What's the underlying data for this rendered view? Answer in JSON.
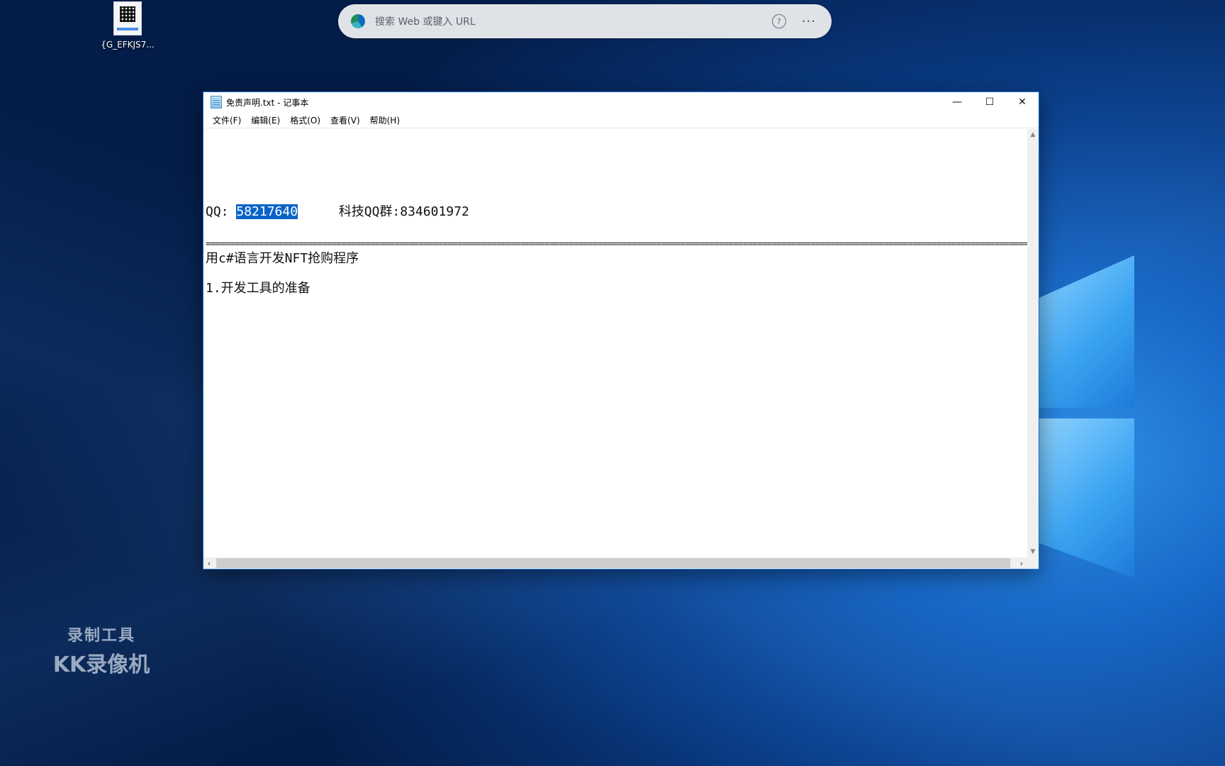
{
  "desktop": {
    "icon_label": "{G_EFKJS7...",
    "watermark_line1": "录制工具",
    "watermark_line2": "KK录像机"
  },
  "browser_bar": {
    "placeholder": "搜索 Web 或键入 URL",
    "help_glyph": "?",
    "more_glyph": "···"
  },
  "notepad": {
    "title": "免责声明.txt - 记事本",
    "menu": [
      "文件(F)",
      "编辑(E)",
      "格式(O)",
      "查看(V)",
      "帮助(H)"
    ],
    "content": {
      "qq_label": "QQ:",
      "qq_number": "58217640",
      "group_text": "科技QQ群:834601972",
      "separator": "==================================================================================================================================================================================",
      "line_title": "用c#语言开发NFT抢购程序",
      "line_item1": "1.开发工具的准备"
    },
    "controls": {
      "minimize": "—",
      "maximize": "☐",
      "close": "✕"
    }
  },
  "colors": {
    "selection": "#0a64c8",
    "window_border": "#1c6fd1"
  }
}
